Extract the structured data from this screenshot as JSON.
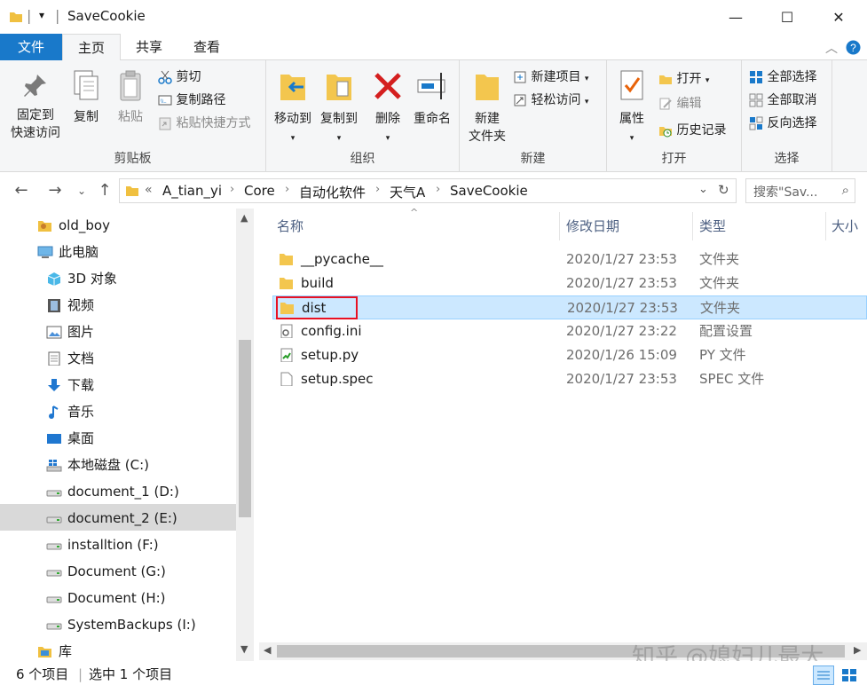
{
  "window": {
    "title": "SaveCookie",
    "quick_access_chevron": "▾",
    "minimize": "—",
    "maximize": "☐",
    "close": "✕"
  },
  "tabs": [
    "文件",
    "主页",
    "共享",
    "查看"
  ],
  "ribbon": {
    "clipboard": {
      "label": "剪贴板",
      "pin": [
        "固定到",
        "快速访问"
      ],
      "copy": "复制",
      "paste": "粘贴",
      "cut": "剪切",
      "copy_path": "复制路径",
      "paste_shortcut": "粘贴快捷方式"
    },
    "organize": {
      "label": "组织",
      "move_to": "移动到",
      "copy_to": "复制到",
      "delete": "删除",
      "rename": "重命名"
    },
    "new": {
      "label": "新建",
      "new_folder": [
        "新建",
        "文件夹"
      ],
      "new_item": "新建项目",
      "easy_access": "轻松访问"
    },
    "open": {
      "label": "打开",
      "properties": "属性",
      "open": "打开",
      "edit": "编辑",
      "history": "历史记录"
    },
    "select": {
      "label": "选择",
      "select_all": "全部选择",
      "select_none": "全部取消",
      "invert": "反向选择"
    }
  },
  "address": {
    "overflow": "«",
    "crumbs": [
      "A_tian_yi",
      "Core",
      "自动化软件",
      "天气A",
      "SaveCookie"
    ],
    "search_placeholder": "搜索\"Sav...",
    "search_icon": "⌕"
  },
  "nav": {
    "items": [
      {
        "label": "old_boy",
        "icon": "user-folder"
      },
      {
        "label": "此电脑",
        "icon": "pc"
      },
      {
        "label": "3D 对象",
        "icon": "cube"
      },
      {
        "label": "视频",
        "icon": "film"
      },
      {
        "label": "图片",
        "icon": "picture"
      },
      {
        "label": "文档",
        "icon": "document"
      },
      {
        "label": "下载",
        "icon": "download"
      },
      {
        "label": "音乐",
        "icon": "music"
      },
      {
        "label": "桌面",
        "icon": "desktop"
      },
      {
        "label": "本地磁盘 (C:)",
        "icon": "drive-windows"
      },
      {
        "label": "document_1 (D:)",
        "icon": "drive"
      },
      {
        "label": "document_2 (E:)",
        "icon": "drive"
      },
      {
        "label": "installtion (F:)",
        "icon": "drive"
      },
      {
        "label": "Document (G:)",
        "icon": "drive"
      },
      {
        "label": "Document (H:)",
        "icon": "drive"
      },
      {
        "label": "SystemBackups (I:)",
        "icon": "drive"
      },
      {
        "label": "库",
        "icon": "library"
      }
    ],
    "selected_index": 11
  },
  "columns": {
    "name": "名称",
    "modified": "修改日期",
    "type": "类型",
    "size": "大小"
  },
  "files": [
    {
      "name": "__pycache__",
      "modified": "2020/1/27 23:53",
      "type": "文件夹",
      "icon": "folder"
    },
    {
      "name": "build",
      "modified": "2020/1/27 23:53",
      "type": "文件夹",
      "icon": "folder"
    },
    {
      "name": "dist",
      "modified": "2020/1/27 23:53",
      "type": "文件夹",
      "icon": "folder"
    },
    {
      "name": "config.ini",
      "modified": "2020/1/27 23:22",
      "type": "配置设置",
      "icon": "ini-file"
    },
    {
      "name": "setup.py",
      "modified": "2020/1/26 15:09",
      "type": "PY 文件",
      "icon": "python-file"
    },
    {
      "name": "setup.spec",
      "modified": "2020/1/27 23:53",
      "type": "SPEC 文件",
      "icon": "blank-file"
    }
  ],
  "selected_file_index": 2,
  "status": {
    "count": "6 个项目",
    "selected": "选中 1 个项目"
  },
  "watermark": "知乎 @媳妇儿最大",
  "colors": {
    "accent": "#1979ca",
    "selection": "#cce8ff",
    "highlight_box": "#e81123"
  }
}
